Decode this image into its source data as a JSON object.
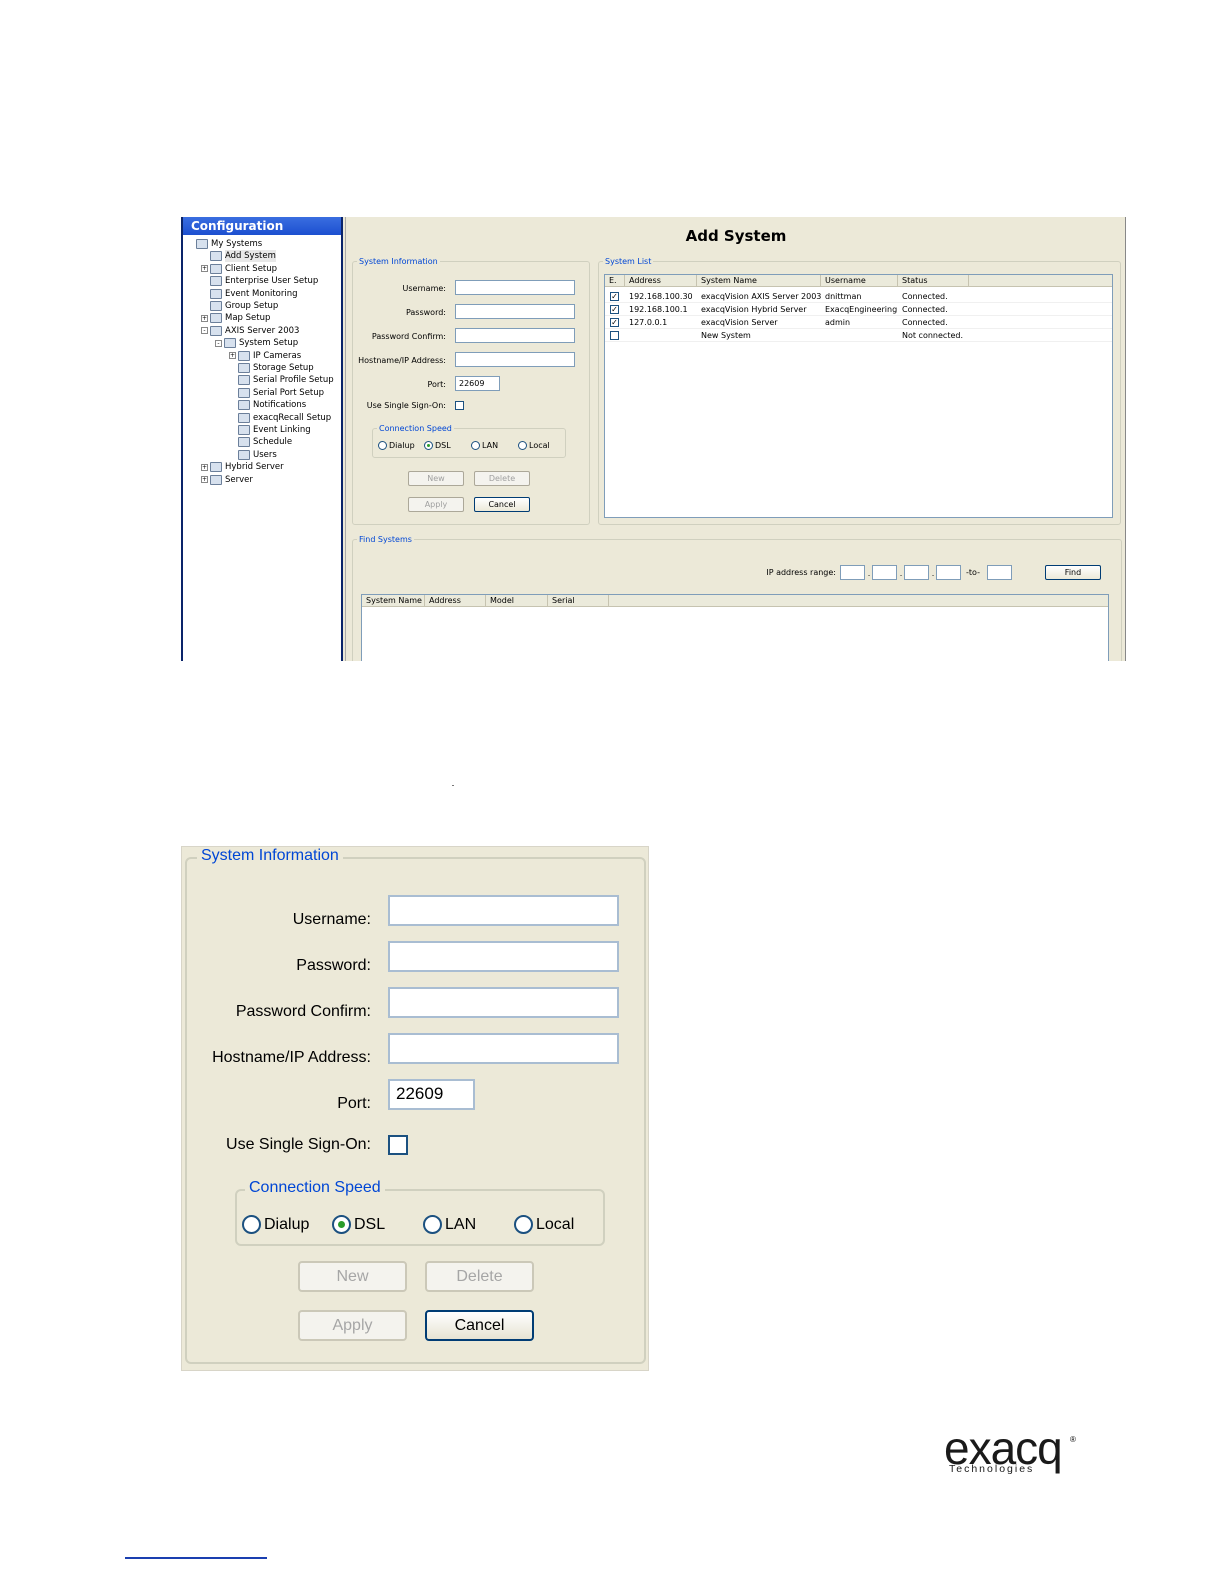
{
  "config_panel": {
    "title": "Configuration",
    "tree": [
      {
        "label": "My Systems",
        "depth": 0,
        "expander": "",
        "icon": "network-icon"
      },
      {
        "label": "Add System",
        "depth": 1,
        "expander": "",
        "icon": "add-system-icon",
        "selected": true
      },
      {
        "label": "Client Setup",
        "depth": 1,
        "expander": "+",
        "icon": "client-setup-icon"
      },
      {
        "label": "Enterprise User Setup",
        "depth": 1,
        "expander": "",
        "icon": "users-icon"
      },
      {
        "label": "Event Monitoring",
        "depth": 1,
        "expander": "",
        "icon": "monitor-icon"
      },
      {
        "label": "Group Setup",
        "depth": 1,
        "expander": "",
        "icon": "group-icon"
      },
      {
        "label": "Map Setup",
        "depth": 1,
        "expander": "+",
        "icon": "map-icon"
      },
      {
        "label": "AXIS Server 2003",
        "depth": 1,
        "expander": "-",
        "icon": "server-icon"
      },
      {
        "label": "System Setup",
        "depth": 2,
        "expander": "-",
        "icon": "system-setup-icon"
      },
      {
        "label": "IP Cameras",
        "depth": 3,
        "expander": "+",
        "icon": "camera-icon"
      },
      {
        "label": "Storage Setup",
        "depth": 3,
        "expander": "",
        "icon": "storage-icon"
      },
      {
        "label": "Serial Profile Setup",
        "depth": 3,
        "expander": "",
        "icon": "serial-profile-icon"
      },
      {
        "label": "Serial Port Setup",
        "depth": 3,
        "expander": "",
        "icon": "serial-port-icon"
      },
      {
        "label": "Notifications",
        "depth": 3,
        "expander": "",
        "icon": "mail-icon"
      },
      {
        "label": "exacqRecall Setup",
        "depth": 3,
        "expander": "",
        "icon": "recall-icon"
      },
      {
        "label": "Event Linking",
        "depth": 3,
        "expander": "",
        "icon": "link-icon"
      },
      {
        "label": "Schedule",
        "depth": 3,
        "expander": "",
        "icon": "calendar-icon"
      },
      {
        "label": "Users",
        "depth": 3,
        "expander": "",
        "icon": "users-icon"
      },
      {
        "label": "Hybrid Server",
        "depth": 1,
        "expander": "+",
        "icon": "server-icon"
      },
      {
        "label": "Server",
        "depth": 1,
        "expander": "+",
        "icon": "server-icon"
      }
    ]
  },
  "add_system": {
    "title": "Add System",
    "system_information": {
      "legend": "System Information",
      "username_label": "Username:",
      "password_label": "Password:",
      "password_confirm_label": "Password Confirm:",
      "hostname_label": "Hostname/IP Address:",
      "port_label": "Port:",
      "port_value": "22609",
      "sso_label": "Use Single Sign-On:",
      "connection_speed": {
        "legend": "Connection Speed",
        "options": [
          "Dialup",
          "DSL",
          "LAN",
          "Local"
        ],
        "selected": "DSL"
      },
      "buttons": {
        "new": "New",
        "delete": "Delete",
        "apply": "Apply",
        "cancel": "Cancel"
      }
    },
    "system_list": {
      "legend": "System List",
      "columns": [
        "E.",
        "Address",
        "System Name",
        "Username",
        "Status"
      ],
      "rows": [
        {
          "checked": true,
          "address": "192.168.100.30",
          "system_name": "exacqVision AXIS Server 2003",
          "username": "dnittman",
          "status": "Connected."
        },
        {
          "checked": true,
          "address": "192.168.100.1",
          "system_name": "exacqVision Hybrid Server",
          "username": "ExacqEngineering",
          "status": "Connected."
        },
        {
          "checked": true,
          "address": "127.0.0.1",
          "system_name": "exacqVision Server",
          "username": "admin",
          "status": "Connected."
        },
        {
          "checked": false,
          "address": "",
          "system_name": "New System",
          "username": "",
          "status": "Not connected."
        }
      ]
    },
    "find_systems": {
      "legend": "Find Systems",
      "ip_range_label": "IP address range:",
      "dot": ".",
      "to_label": "-to-",
      "find_button": "Find",
      "columns": [
        "System Name",
        "Address",
        "Model",
        "Serial"
      ]
    }
  },
  "logo": {
    "main": "exacq",
    "sub": "Technologies",
    "reg": "®"
  }
}
